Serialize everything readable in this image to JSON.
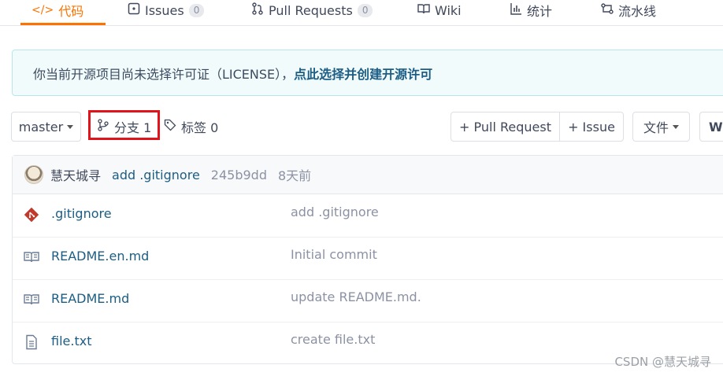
{
  "tabs": [
    {
      "label": "代码",
      "icon": "code-icon",
      "active": true
    },
    {
      "label": "Issues",
      "icon": "issues-icon",
      "count": "0"
    },
    {
      "label": "Pull Requests",
      "icon": "pull-request-icon",
      "count": "0"
    },
    {
      "label": "Wiki",
      "icon": "book-icon"
    },
    {
      "label": "统计",
      "icon": "bar-chart-icon"
    },
    {
      "label": "流水线",
      "icon": "pipeline-icon"
    }
  ],
  "notice": {
    "text": "你当前开源项目尚未选择许可证（LICENSE），",
    "link": "点此选择并创建开源许可"
  },
  "toolbar": {
    "branch_select": "master",
    "branches": "分支 1",
    "tags": "标签 0",
    "pull_request": "+ Pull Request",
    "issue": "+ Issue",
    "files": "文件",
    "web_ide": "W"
  },
  "commit": {
    "author": "慧天城寻",
    "message": "add .gitignore",
    "sha": "245b9dd",
    "time": "8天前"
  },
  "files": [
    {
      "name": ".gitignore",
      "message": "add .gitignore",
      "icon": "git-file-icon"
    },
    {
      "name": "README.en.md",
      "message": "Initial commit",
      "icon": "readme-icon"
    },
    {
      "name": "README.md",
      "message": "update README.md.",
      "icon": "readme-icon"
    },
    {
      "name": "file.txt",
      "message": "create file.txt",
      "icon": "text-file-icon"
    }
  ],
  "watermark": "CSDN @慧天城寻",
  "colors": {
    "accent": "#fe7300",
    "link": "#1c5d84",
    "highlight": "#e1141b",
    "notice_bg": "#f1fbfc"
  }
}
